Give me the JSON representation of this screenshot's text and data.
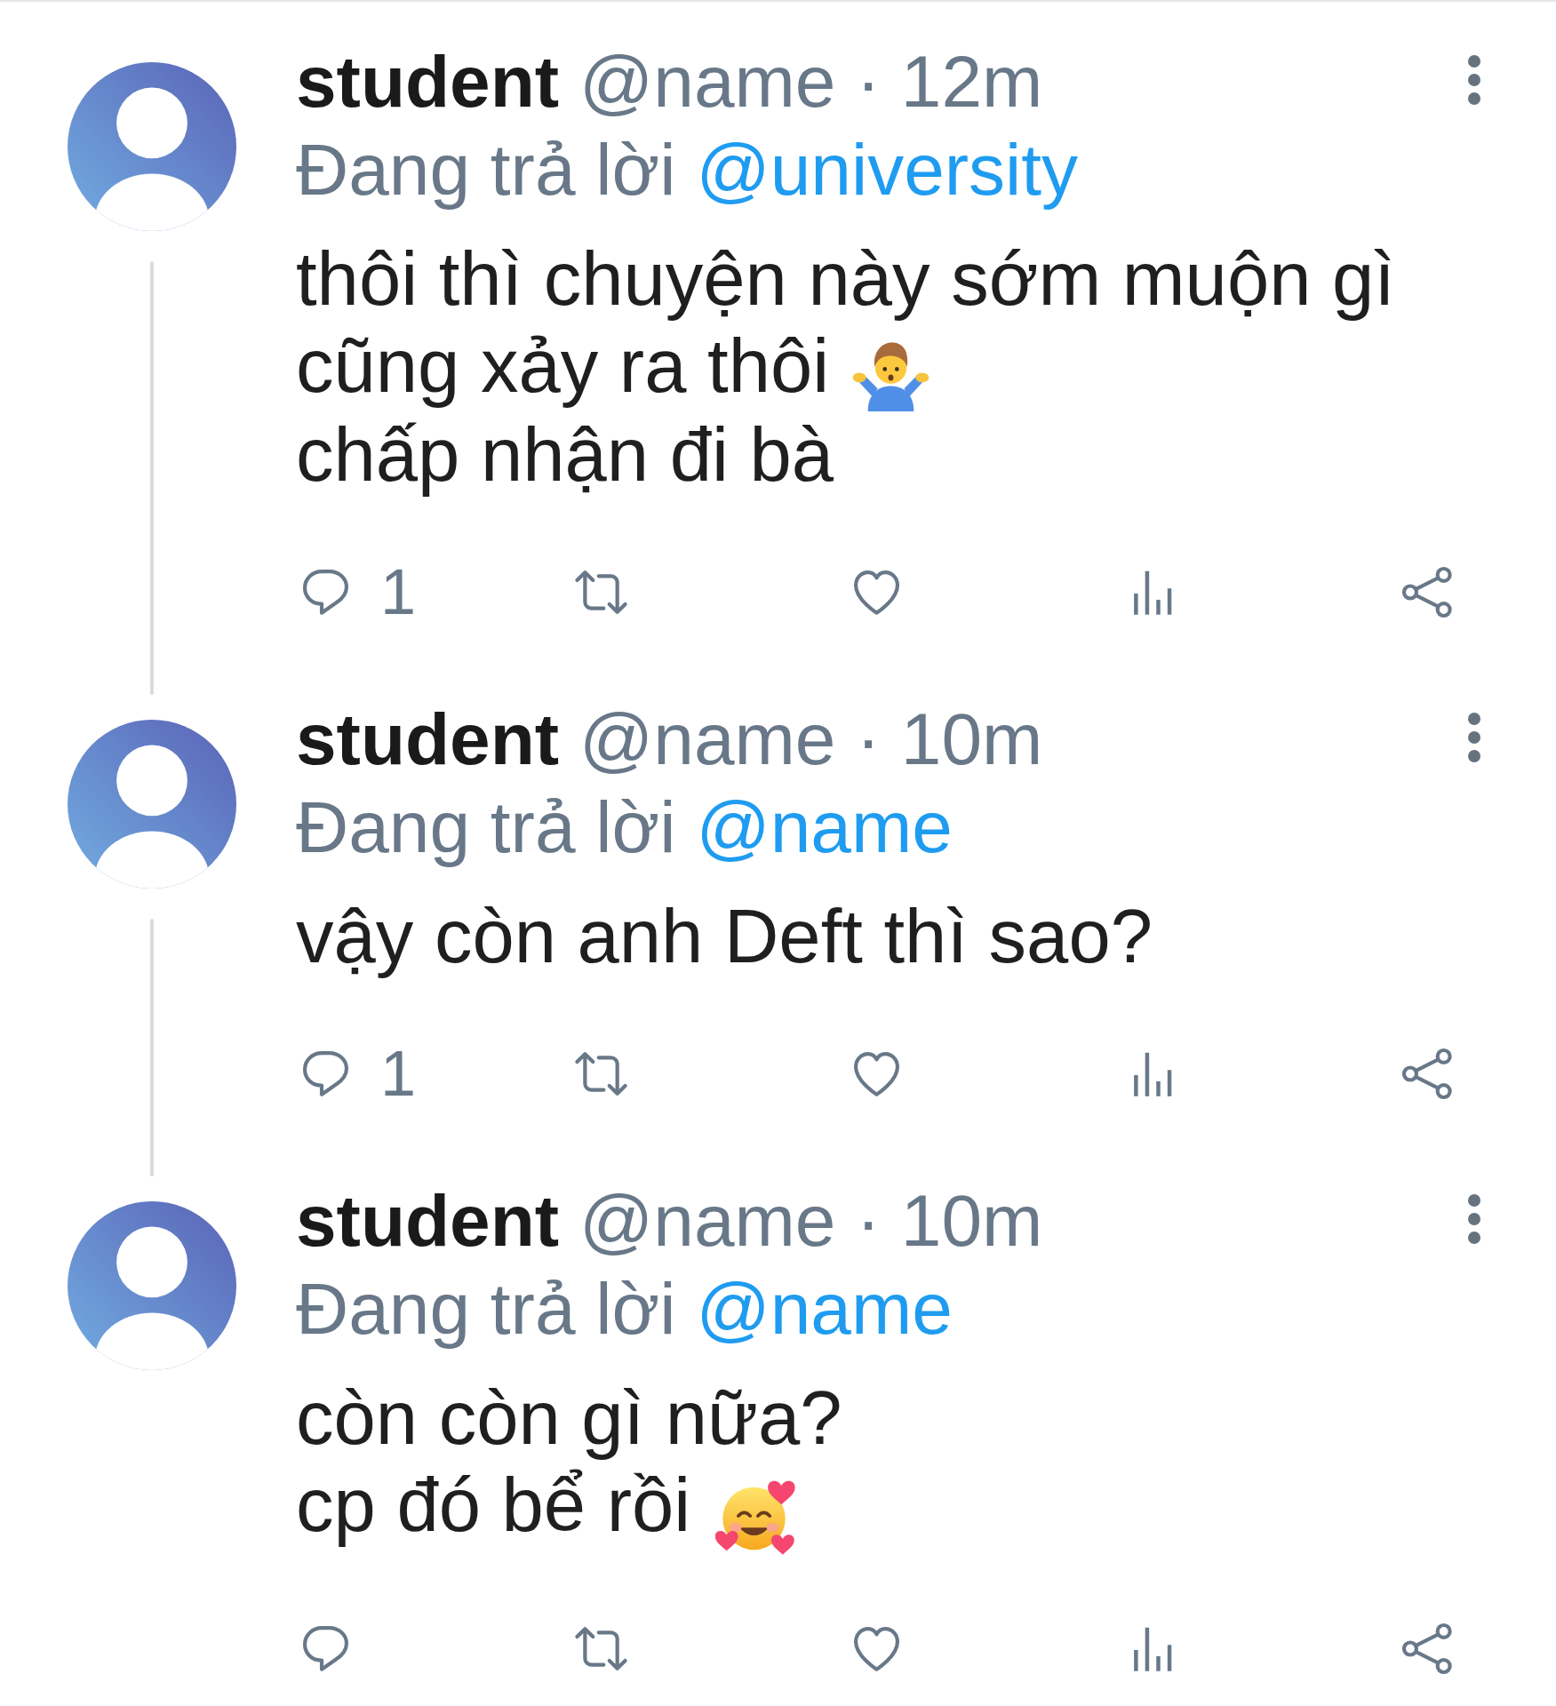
{
  "tweets": [
    {
      "name": "student",
      "handle": "@name",
      "separator": "·",
      "time": "12m",
      "reply_prefix": "Đang trả lời",
      "reply_to": "@university",
      "body": [
        {
          "kind": "plain",
          "text": "thôi thì chuyện này sớm muộn gì"
        },
        {
          "kind": "shrug",
          "text": "cũng xảy ra thôi"
        },
        {
          "kind": "plain",
          "text": "chấp nhận đi bà"
        }
      ],
      "reply_count": "1",
      "retweeted": false,
      "liked": false
    },
    {
      "name": "student",
      "handle": "@name",
      "separator": "·",
      "time": "10m",
      "reply_prefix": "Đang trả lời",
      "reply_to": "@name",
      "body": [
        {
          "kind": "plain",
          "text": "vậy còn anh Deft thì sao?"
        }
      ],
      "reply_count": "1",
      "retweeted": false,
      "liked": false
    },
    {
      "name": "student",
      "handle": "@name",
      "separator": "·",
      "time": "10m",
      "reply_prefix": "Đang trả lời",
      "reply_to": "@name",
      "body": [
        {
          "kind": "plain",
          "text": "còn còn gì nữa?"
        },
        {
          "kind": "hearts",
          "text": "cp đó bể rồi"
        }
      ],
      "retweeted": false,
      "liked": false
    }
  ]
}
